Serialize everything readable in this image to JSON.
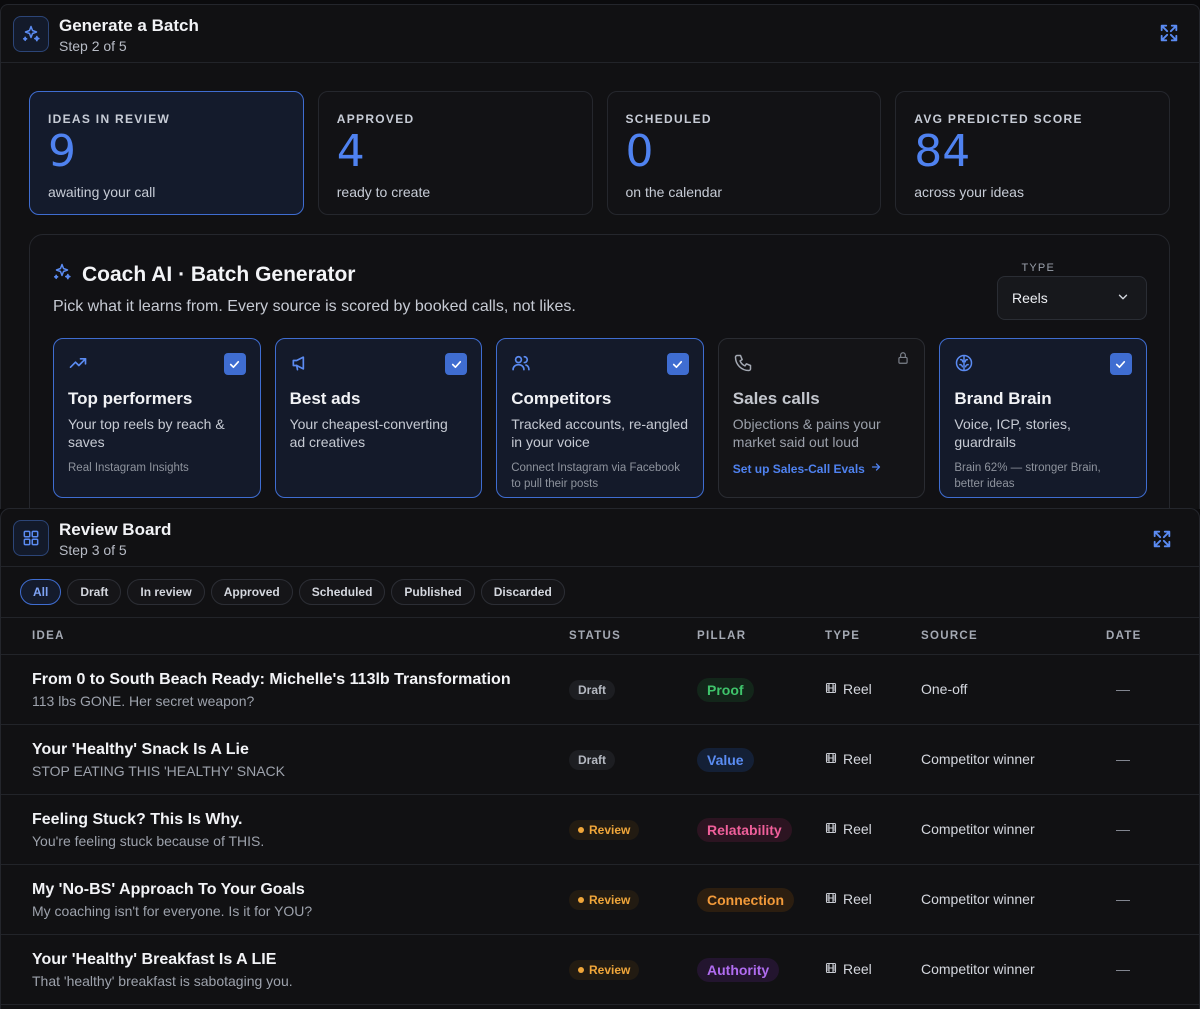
{
  "batch": {
    "title": "Generate a Batch",
    "step": "Step 2 of 5",
    "stats": [
      {
        "label": "IDEAS IN REVIEW",
        "value": "9",
        "desc": "awaiting your call"
      },
      {
        "label": "APPROVED",
        "value": "4",
        "desc": "ready to create"
      },
      {
        "label": "SCHEDULED",
        "value": "0",
        "desc": "on the calendar"
      },
      {
        "label": "AVG PREDICTED SCORE",
        "value": "84",
        "desc": "across your ideas"
      }
    ],
    "generator": {
      "title": "Coach AI · Batch Generator",
      "desc": "Pick what it learns from. Every source is scored by booked calls, not likes.",
      "type_label": "TYPE",
      "type_value": "Reels"
    },
    "sources": [
      {
        "title": "Top performers",
        "desc": "Your top reels by reach & saves",
        "foot": "Real Instagram Insights",
        "icon": "trending-up-icon"
      },
      {
        "title": "Best ads",
        "desc": "Your cheapest-converting ad creatives",
        "foot": "",
        "icon": "megaphone-icon"
      },
      {
        "title": "Competitors",
        "desc": "Tracked accounts, re-angled in your voice",
        "foot": "Connect Instagram via Facebook to pull their posts",
        "icon": "users-icon"
      },
      {
        "title": "Sales calls",
        "desc": "Objections & pains your market said out loud",
        "link": "Set up Sales-Call Evals",
        "icon": "phone-icon"
      },
      {
        "title": "Brand Brain",
        "desc": "Voice, ICP, stories, guardrails",
        "foot": "Brain 62% — stronger Brain, better ideas",
        "icon": "brain-icon"
      }
    ]
  },
  "review": {
    "title": "Review Board",
    "step": "Step 3 of 5",
    "filters": [
      "All",
      "Draft",
      "In review",
      "Approved",
      "Scheduled",
      "Published",
      "Discarded"
    ],
    "columns": [
      "IDEA",
      "STATUS",
      "PILLAR",
      "TYPE",
      "SOURCE",
      "DATE"
    ],
    "rows": [
      {
        "title": "From 0 to South Beach Ready: Michelle's 113lb Transformation",
        "sub": "113 lbs GONE. Her secret weapon?",
        "status": "Draft",
        "pillar": "Proof",
        "type": "Reel",
        "source": "One-off",
        "date": "—"
      },
      {
        "title": "Your 'Healthy' Snack Is A Lie",
        "sub": "STOP EATING THIS 'HEALTHY' SNACK",
        "status": "Draft",
        "pillar": "Value",
        "type": "Reel",
        "source": "Competitor winner",
        "date": "—"
      },
      {
        "title": "Feeling Stuck? This Is Why.",
        "sub": "You're feeling stuck because of THIS.",
        "status": "Review",
        "pillar": "Relatability",
        "type": "Reel",
        "source": "Competitor winner",
        "date": "—"
      },
      {
        "title": "My 'No-BS' Approach To Your Goals",
        "sub": "My coaching isn't for everyone. Is it for YOU?",
        "status": "Review",
        "pillar": "Connection",
        "type": "Reel",
        "source": "Competitor winner",
        "date": "—"
      },
      {
        "title": "Your 'Healthy' Breakfast Is A LIE",
        "sub": "That 'healthy' breakfast is sabotaging you.",
        "status": "Review",
        "pillar": "Authority",
        "type": "Reel",
        "source": "Competitor winner",
        "date": "—"
      }
    ]
  },
  "colors": {
    "accent": "#4f82f0",
    "proof": "#3fc46b",
    "value": "#5a8cf2",
    "relatability": "#ef5f9a",
    "connection": "#f29a3a",
    "authority": "#b06cf0"
  }
}
